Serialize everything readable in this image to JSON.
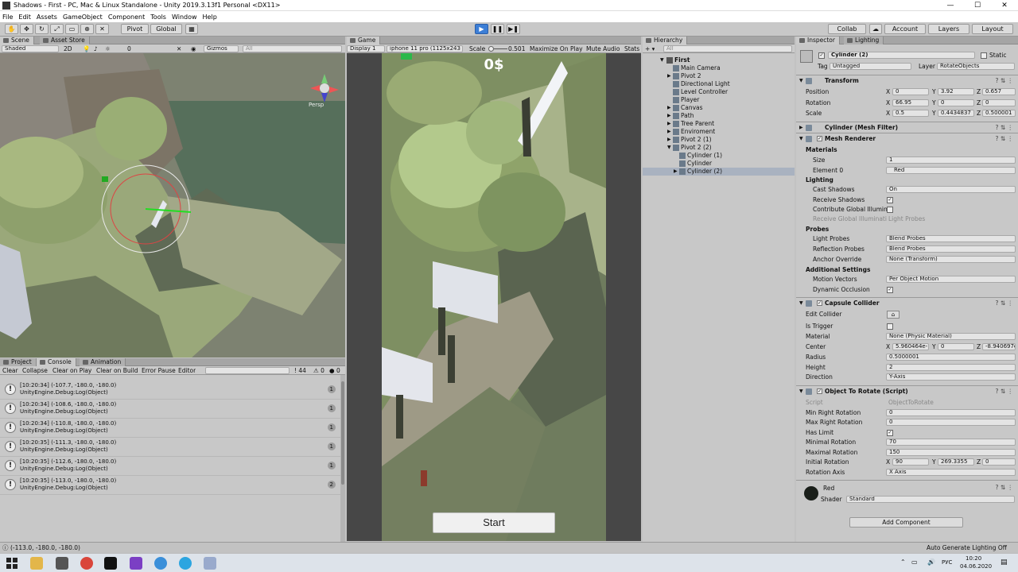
{
  "window": {
    "title": "Shadows - First - PC, Mac & Linux Standalone - Unity 2019.3.13f1 Personal <DX11>",
    "minimize": "—",
    "maximize": "☐",
    "close": "✕"
  },
  "menu": [
    "File",
    "Edit",
    "Assets",
    "GameObject",
    "Component",
    "Tools",
    "Window",
    "Help"
  ],
  "toolbar": {
    "pivot": "Pivot",
    "global": "Global",
    "collab": "Collab",
    "account": "Account",
    "layers": "Layers",
    "layout": "Layout",
    "play": "▶",
    "pause": "❚❚",
    "step": "▶❚"
  },
  "scene": {
    "tab_scene": "Scene",
    "tab_asset_store": "Asset Store",
    "shading": "Shaded",
    "mode_2d": "2D",
    "gizmos": "Gizmos",
    "search_placeholder": "All",
    "persp": "Persp",
    "layer_count": "0"
  },
  "game": {
    "tab": "Game",
    "display": "Display 1",
    "resolution": "iphone 11 pro (1125x243",
    "scale_label": "Scale",
    "scale_value": "0.501",
    "maximize": "Maximize On Play",
    "mute": "Mute Audio",
    "stats": "Stats",
    "money": "0$",
    "start": "Start"
  },
  "hierarchy": {
    "tab": "Hierarchy",
    "search_placeholder": "All",
    "items": [
      {
        "label": "First",
        "indent": 0,
        "expanded": true,
        "selected": false
      },
      {
        "label": "Main Camera",
        "indent": 1,
        "selected": false
      },
      {
        "label": "Pivot 2",
        "indent": 1,
        "selected": false
      },
      {
        "label": "Directional Light",
        "indent": 1,
        "selected": false
      },
      {
        "label": "Level Controller",
        "indent": 1,
        "selected": false
      },
      {
        "label": "Player",
        "indent": 1,
        "selected": false
      },
      {
        "label": "Canvas",
        "indent": 1,
        "selected": false
      },
      {
        "label": "Path",
        "indent": 1,
        "selected": false
      },
      {
        "label": "Tree Parent",
        "indent": 1,
        "selected": false
      },
      {
        "label": "Enviroment",
        "indent": 1,
        "selected": false
      },
      {
        "label": "Pivot 2 (1)",
        "indent": 1,
        "selected": false
      },
      {
        "label": "Pivot 2 (2)",
        "indent": 1,
        "selected": false
      },
      {
        "label": "Cylinder (1)",
        "indent": 2,
        "selected": false
      },
      {
        "label": "Cylinder",
        "indent": 2,
        "selected": false
      },
      {
        "label": "Cylinder (2)",
        "indent": 2,
        "selected": true
      }
    ]
  },
  "inspector": {
    "tab": "Inspector",
    "tab_lighting": "Lighting",
    "object_name": "Cylinder (2)",
    "static": "Static",
    "tag_label": "Tag",
    "tag": "Untagged",
    "layer_label": "Layer",
    "layer": "RotateObjects",
    "transform": {
      "title": "Transform",
      "position_label": "Position",
      "position": [
        "0",
        "3.92",
        "0.657"
      ],
      "rotation_label": "Rotation",
      "rotation": [
        "66.95",
        "0",
        "0"
      ],
      "scale_label": "Scale",
      "scale": [
        "0.5",
        "0.4434837",
        "0.500001"
      ]
    },
    "mesh_filter": "Cylinder (Mesh Filter)",
    "mesh_renderer": {
      "title": "Mesh Renderer",
      "materials": "Materials",
      "size_label": "Size",
      "size": "1",
      "element0_label": "Element 0",
      "element0": "Red",
      "lighting": "Lighting",
      "cast_shadows_label": "Cast Shadows",
      "cast_shadows": "On",
      "receive_shadows": "Receive Shadows",
      "contribute_gi": "Contribute Global Illumina",
      "receive_gi_label": "Receive Global Illuminati",
      "receive_gi": "Light Probes",
      "probes": "Probes",
      "light_probes_label": "Light Probes",
      "light_probes": "Blend Probes",
      "reflection_probes_label": "Reflection Probes",
      "reflection_probes": "Blend Probes",
      "anchor_override_label": "Anchor Override",
      "anchor_override": "None (Transform)",
      "additional": "Additional Settings",
      "motion_vectors_label": "Motion Vectors",
      "motion_vectors": "Per Object Motion",
      "dynamic_occlusion": "Dynamic Occlusion"
    },
    "capsule": {
      "title": "Capsule Collider",
      "edit_collider": "Edit Collider",
      "is_trigger": "Is Trigger",
      "material_label": "Material",
      "material": "None (Physic Material)",
      "center_label": "Center",
      "center": [
        "5.960464e-",
        "0",
        "-8.940697e"
      ],
      "radius_label": "Radius",
      "radius": "0.5000001",
      "height_label": "Height",
      "height": "2",
      "direction_label": "Direction",
      "direction": "Y-Axis"
    },
    "script": {
      "title": "Object To Rotate (Script)",
      "script_label": "Script",
      "script": "ObjectToRotate",
      "min_right_label": "Min Right Rotation",
      "min_right": "0",
      "max_right_label": "Max Right Rotation",
      "max_right": "0",
      "has_limit": "Has Limit",
      "minimal_label": "Minimal Rotation",
      "minimal": "70",
      "maximal_label": "Maximal Rotation",
      "maximal": "150",
      "initial_label": "Initial Rotation",
      "initial": [
        "90",
        "269.3355",
        "0"
      ],
      "axis_label": "Rotation Axis",
      "axis": "X Axis"
    },
    "material": {
      "name": "Red",
      "shader_label": "Shader",
      "shader": "Standard"
    },
    "add_component": "Add Component"
  },
  "console": {
    "tab_project": "Project",
    "tab_console": "Console",
    "tab_animation": "Animation",
    "clear": "Clear",
    "collapse": "Collapse",
    "clear_on_play": "Clear on Play",
    "clear_on_build": "Clear on Build",
    "error_pause": "Error Pause",
    "editor": "Editor",
    "count_log": "44",
    "count_warn": "0",
    "count_err": "0",
    "entries": [
      {
        "line1": "[10:20:34] (-107.7, -180.0, -180.0)",
        "line2": "UnityEngine.Debug:Log(Object)",
        "count": "1"
      },
      {
        "line1": "[10:20:34] (-108.6, -180.0, -180.0)",
        "line2": "UnityEngine.Debug:Log(Object)",
        "count": "1"
      },
      {
        "line1": "[10:20:34] (-110.8, -180.0, -180.0)",
        "line2": "UnityEngine.Debug:Log(Object)",
        "count": "1"
      },
      {
        "line1": "[10:20:35] (-111.3, -180.0, -180.0)",
        "line2": "UnityEngine.Debug:Log(Object)",
        "count": "1"
      },
      {
        "line1": "[10:20:35] (-112.6, -180.0, -180.0)",
        "line2": "UnityEngine.Debug:Log(Object)",
        "count": "1"
      },
      {
        "line1": "[10:20:35] (-113.0, -180.0, -180.0)",
        "line2": "UnityEngine.Debug:Log(Object)",
        "count": "2"
      }
    ]
  },
  "status": {
    "message": "(-113.0, -180.0, -180.0)",
    "right": "Auto Generate Lighting Off"
  },
  "taskbar": {
    "lang": "РУС",
    "time": "10:20",
    "date": "04.06.2020"
  }
}
